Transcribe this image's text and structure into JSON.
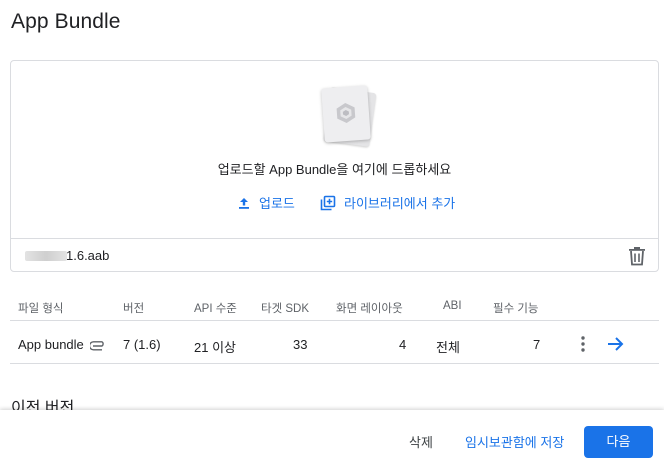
{
  "page": {
    "title": "App Bundle"
  },
  "upload": {
    "drop_text": "업로드할 App Bundle을 여기에 드롭하세요",
    "upload_label": "업로드",
    "library_label": "라이브러리에서 추가",
    "file_name": "1.6.aab"
  },
  "table": {
    "headers": [
      "파일 형식",
      "버전",
      "API 수준",
      "타겟 SDK",
      "화면 레이아웃",
      "ABI",
      "필수 기능"
    ],
    "row": {
      "file_type": "App bundle",
      "version": "7 (1.6)",
      "api_level": "21 이상",
      "target_sdk": "33",
      "screen_layouts": "4",
      "abi": "전체",
      "required_features": "7"
    }
  },
  "previous": {
    "title": "이전 버전"
  },
  "footer": {
    "delete_label": "삭제",
    "save_draft_label": "임시보관함에 저장",
    "next_label": "다음"
  },
  "colors": {
    "accent": "#1a73e8",
    "border": "#dadce0",
    "text": "#202124",
    "muted": "#5f6368"
  },
  "icons": [
    "document-stack-icon",
    "upload-icon",
    "library-add-icon",
    "trash-icon",
    "paperclip-icon",
    "more-vert-icon",
    "arrow-forward-icon"
  ]
}
